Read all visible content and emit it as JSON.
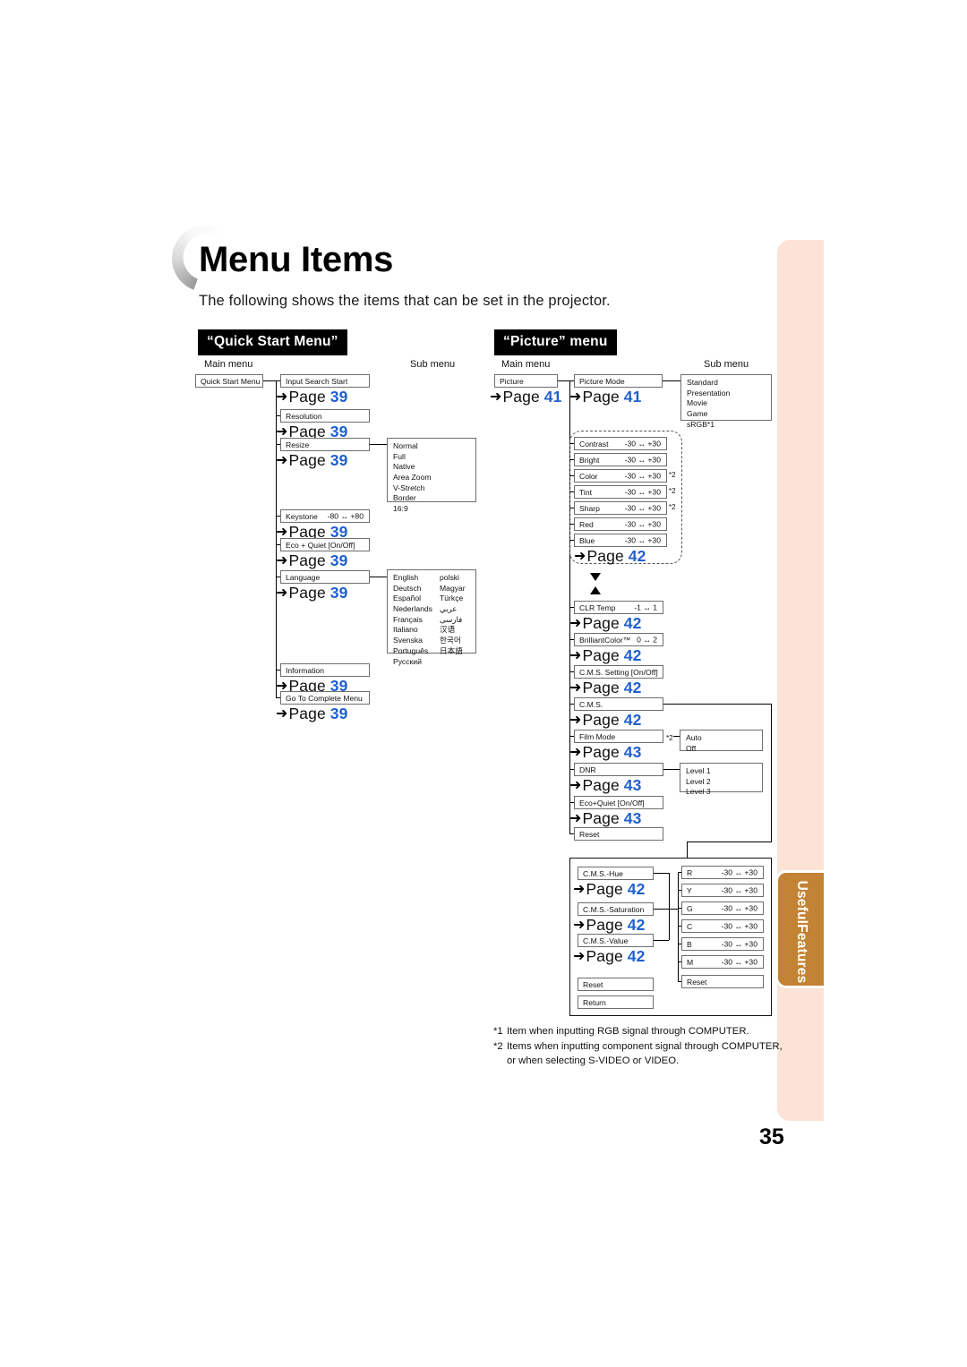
{
  "header": {
    "title": "Menu Items",
    "intro": "The following shows the items that can be set in the projector."
  },
  "side_tab": {
    "line1": "Useful",
    "line2": "Features",
    "color": "#c28334"
  },
  "band_color": "#fce3d6",
  "accent_page_color": "#1f5fd0",
  "folio": "35",
  "labels": {
    "main_menu": "Main menu",
    "sub_menu": "Sub menu",
    "page_word": "Page",
    "arrow": "➜"
  },
  "quick_start": {
    "banner": "“Quick Start Menu”",
    "main": "Quick Start Menu",
    "items": [
      {
        "label": "Input Search Start",
        "value": "",
        "page": "39"
      },
      {
        "label": "Resolution",
        "value": "",
        "page": "39"
      },
      {
        "label": "Resize",
        "value": "",
        "page": "39"
      },
      {
        "label": "Keystone",
        "value": "-80 ↔ +80",
        "page": "39"
      },
      {
        "label": "Eco + Quiet [On/Off]",
        "value": "",
        "page": "39"
      },
      {
        "label": "Language",
        "value": "",
        "page": "39"
      },
      {
        "label": "Information",
        "value": "",
        "page": "39"
      },
      {
        "label": "Go To Complete Menu",
        "value": "",
        "page": "39"
      }
    ],
    "resize_options": [
      "Normal",
      "Full",
      "Native",
      "Area Zoom",
      "V-Stretch",
      "Border",
      "16:9"
    ],
    "language_col1": [
      "English",
      "Deutsch",
      "Español",
      "Nederlands",
      "Français",
      "Italiano",
      "Svenska",
      "Português",
      "Русский"
    ],
    "language_col2": [
      "polski",
      "Magyar",
      "Türkçe",
      "عربي",
      "فارسی",
      "汉语",
      "한국어",
      "日本語"
    ]
  },
  "picture": {
    "banner": "“Picture” menu",
    "main": {
      "label": "Picture",
      "page": "41"
    },
    "picture_mode": {
      "label": "Picture Mode",
      "page": "41"
    },
    "picture_mode_options": [
      "Standard",
      "Presentation",
      "Movie",
      "Game",
      "sRGB*1"
    ],
    "adjust_group": {
      "page": "42",
      "rows": [
        {
          "label": "Contrast",
          "value": "-30 ↔ +30",
          "note": ""
        },
        {
          "label": "Bright",
          "value": "-30 ↔ +30",
          "note": ""
        },
        {
          "label": "Color",
          "value": "-30 ↔ +30",
          "note": "*2"
        },
        {
          "label": "Tint",
          "value": "-30 ↔ +30",
          "note": "*2"
        },
        {
          "label": "Sharp",
          "value": "-30 ↔ +30",
          "note": "*2"
        },
        {
          "label": "Red",
          "value": "-30 ↔ +30",
          "note": ""
        },
        {
          "label": "Blue",
          "value": "-30 ↔ +30",
          "note": ""
        }
      ]
    },
    "items": [
      {
        "label": "CLR Temp",
        "value": "-1 ↔ 1",
        "page": "42",
        "note": ""
      },
      {
        "label": "BrilliantColor™",
        "value": "0 ↔ 2",
        "page": "42",
        "note": ""
      },
      {
        "label": "C.M.S. Setting [On/Off]",
        "value": "",
        "page": "42",
        "note": ""
      },
      {
        "label": "C.M.S.",
        "value": "",
        "page": "42",
        "note": ""
      },
      {
        "label": "Film Mode",
        "value": "",
        "page": "43",
        "note": "*2"
      },
      {
        "label": "DNR",
        "value": "",
        "page": "43",
        "note": ""
      },
      {
        "label": "Eco+Quiet [On/Off]",
        "value": "",
        "page": "43",
        "note": ""
      },
      {
        "label": "Reset",
        "value": "",
        "page": "",
        "note": ""
      }
    ],
    "film_mode_options": [
      "Auto",
      "Off"
    ],
    "dnr_options": [
      "Level 1",
      "Level 2",
      "Level 3"
    ],
    "cms_group": {
      "rows": [
        {
          "label": "C.M.S.-Hue",
          "page": "42"
        },
        {
          "label": "C.M.S.-Saturation",
          "page": "42"
        },
        {
          "label": "C.M.S.-Value",
          "page": "42"
        }
      ],
      "channels": [
        {
          "label": "R",
          "value": "-30 ↔ +30"
        },
        {
          "label": "Y",
          "value": "-30 ↔ +30"
        },
        {
          "label": "G",
          "value": "-30 ↔ +30"
        },
        {
          "label": "C",
          "value": "-30 ↔ +30"
        },
        {
          "label": "B",
          "value": "-30 ↔ +30"
        },
        {
          "label": "M",
          "value": "-30 ↔ +30"
        },
        {
          "label": "Reset",
          "value": ""
        }
      ],
      "reset": "Reset",
      "return": "Return"
    }
  },
  "footnotes": [
    {
      "marker": "*1",
      "text": "Item when inputting RGB signal through COMPUTER."
    },
    {
      "marker": "*2",
      "text": "Items when inputting component signal through COMPUTER, or when selecting S-VIDEO or VIDEO."
    }
  ]
}
